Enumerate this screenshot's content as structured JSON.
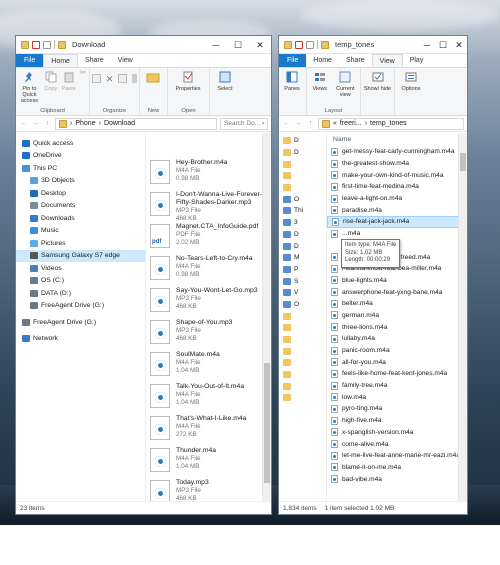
{
  "left_window": {
    "title": "Download",
    "controls": [
      "─",
      "☐",
      "✕"
    ],
    "tabs": [
      "File",
      "Home",
      "Share",
      "View"
    ],
    "ribbon": {
      "clipboard": {
        "label": "Clipboard",
        "buttons": [
          "Pin to Quick access",
          "Copy",
          "Paste",
          "✂"
        ]
      },
      "organize": {
        "label": "Organize"
      },
      "new": {
        "label": "New"
      },
      "open": {
        "label": "Open",
        "properties": "Properties"
      },
      "select": {
        "label": "Select"
      }
    },
    "address": {
      "path": [
        "Phone",
        "Download"
      ],
      "search_placeholder": "Search Do..."
    },
    "nav": [
      {
        "label": "Quick access",
        "color": "#1e73be",
        "indent": 6
      },
      {
        "label": "OneDrive",
        "color": "#1f6fd1",
        "indent": 6
      },
      {
        "label": "This PC",
        "color": "#4a90d9",
        "indent": 6
      },
      {
        "label": "3D Objects",
        "color": "#5aa0e0",
        "indent": 14
      },
      {
        "label": "Desktop",
        "color": "#1a6fb5",
        "indent": 14
      },
      {
        "label": "Documents",
        "color": "#7d8b99",
        "indent": 14
      },
      {
        "label": "Downloads",
        "color": "#2b7fd8",
        "indent": 14
      },
      {
        "label": "Music",
        "color": "#3b8fe0",
        "indent": 14
      },
      {
        "label": "Pictures",
        "color": "#5da9e9",
        "indent": 14
      },
      {
        "label": "Samsung Galaxy S7 edge",
        "color": "#555",
        "indent": 14,
        "selected": true
      },
      {
        "label": "Videos",
        "color": "#4a7fb8",
        "indent": 14
      },
      {
        "label": "OS (C:)",
        "color": "#6b7a89",
        "indent": 14
      },
      {
        "label": "DATA (D:)",
        "color": "#6b7a89",
        "indent": 14
      },
      {
        "label": "FreeAgent Drive (G:)",
        "color": "#6b7a89",
        "indent": 14
      },
      {
        "label": "FreeAgent Drive (G:)",
        "color": "#6b7a89",
        "indent": 6
      },
      {
        "label": "Network",
        "color": "#3a7bc8",
        "indent": 6
      }
    ],
    "files": [
      {
        "name": "M4A File",
        "type": "",
        "size": ""
      },
      {
        "name": "Hey-Brother.m4a",
        "type": "M4A File",
        "size": "0.98 MB"
      },
      {
        "name": "I-Don't-Wanna-Live-Forever-Fifty-Shades-Darker.mp3",
        "type": "MP3 File",
        "size": "468 KB"
      },
      {
        "name": "Magnet.CTA_InfoGuide.pdf",
        "type": "PDF File",
        "size": "2.02 MB",
        "pdf": true
      },
      {
        "name": "No-Tears-Left-to-Cry.m4a",
        "type": "M4A File",
        "size": "0.98 MB"
      },
      {
        "name": "Say-You-Wont-Let-Go.mp3",
        "type": "MP3 File",
        "size": "468 KB"
      },
      {
        "name": "Shape-of-You.mp3",
        "type": "MP3 File",
        "size": "468 KB"
      },
      {
        "name": "SoulMate.m4a",
        "type": "M4A File",
        "size": "1.04 MB"
      },
      {
        "name": "Talk-You-Out-of-It.m4a",
        "type": "M4A File",
        "size": "1.04 MB"
      },
      {
        "name": "That's-What-I-Like.m4a",
        "type": "M4A File",
        "size": "272 KB"
      },
      {
        "name": "Thunder.m4a",
        "type": "M4A File",
        "size": "1.04 MB"
      },
      {
        "name": "Today.mp3",
        "type": "MP3 File",
        "size": "468 KB"
      }
    ],
    "status": "23 items"
  },
  "right_window": {
    "title": "temp_tones",
    "controls": [
      "─",
      "☐",
      "✕"
    ],
    "tabs": [
      "File",
      "Home",
      "Share",
      "View",
      "Play"
    ],
    "ribbon": {
      "panes": "Panes",
      "views": "Views",
      "current_view": "Current view",
      "show_hide": "Show/ hide",
      "options": "Options",
      "layout": "Layout"
    },
    "address": {
      "path": [
        "freeri...",
        "temp_tones"
      ]
    },
    "column_header": "Name",
    "files": [
      "get-messy-feat-carly-cunningham.m4a",
      "the-greatest-show.m4a",
      "make-your-own-kind-of-music.m4a",
      "first-time-feat-medina.m4a",
      "leave-a-light-on.m4a",
      "paradise.m4a",
      "rise-feat-jack-jack.m4a",
      "...m4a",
      "",
      "for-you-fifty-shades-freed.m4a",
      "i-wanna-know-feat-bea-miller.m4a",
      "blue-lights.m4a",
      "answerphone-feat-yxng-bane.m4a",
      "belter.m4a",
      "german.m4a",
      "three-lions.m4a",
      "lullaby.m4a",
      "panic-room.m4a",
      "all-for-you.m4a",
      "feels-like-home-feat-kent-jones.m4a",
      "family-tree.m4a",
      "low.m4a",
      "pyro-ting.m4a",
      "high-five.m4a",
      "x-spanglish-version.m4a",
      "come-alive.m4a",
      "let-me-live-feat-anne-marie-mr-eazi.m4a",
      "blame-it-on-me.m4a",
      "bad-vibe.m4a"
    ],
    "selected_index": 6,
    "tooltip": [
      "Item type: M4A File",
      "Size: 1.02 MB",
      "Length: 00:00:29"
    ],
    "nav_labels": [
      "D",
      "D",
      "",
      "",
      "",
      "O",
      "Thi",
      "3",
      "D",
      "D",
      "M",
      "P",
      "S",
      "V",
      "O",
      "",
      "",
      "",
      "",
      "",
      "",
      "",
      ""
    ],
    "status_count": "1,834 items",
    "status_selected": "1 item selected  1.02 MB"
  },
  "colors": {
    "file_tab": "#1979ca",
    "selection": "#cce8ff",
    "accent": "#2d7ac9"
  }
}
